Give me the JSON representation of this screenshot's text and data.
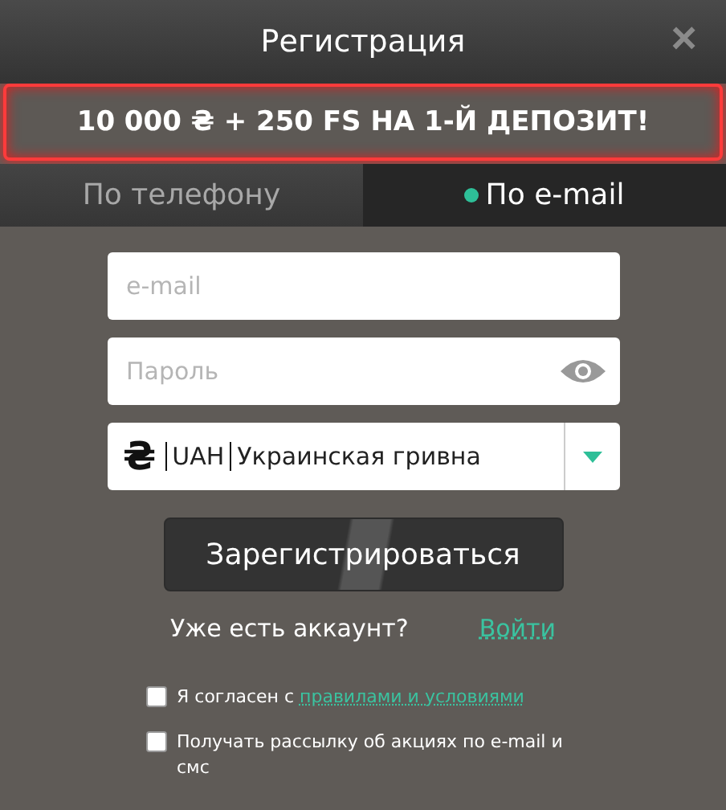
{
  "window": {
    "title": "Регистрация",
    "close": "×"
  },
  "promo": "10 000 ₴ + 250 FS НА 1-Й ДЕПОЗИТ!",
  "tabs": [
    {
      "label": "По телефону",
      "selected": false
    },
    {
      "label": "По e-mail",
      "selected": true
    }
  ],
  "email": {
    "placeholder": "e-mail"
  },
  "password": {
    "placeholder": "Пароль"
  },
  "currency": {
    "sign": "₴",
    "code": "UAH",
    "name": "Украинская гривна"
  },
  "register_button": "Зарегистрироваться",
  "login": {
    "question": "Уже есть аккаунт?",
    "link": "Войти"
  },
  "checkboxes": [
    {
      "text": "Я согласен с ",
      "link": "правилами и условиями",
      "checked": false
    },
    {
      "text": "Получать рассылку об акциях по e-mail и смс",
      "checked": false
    }
  ]
}
